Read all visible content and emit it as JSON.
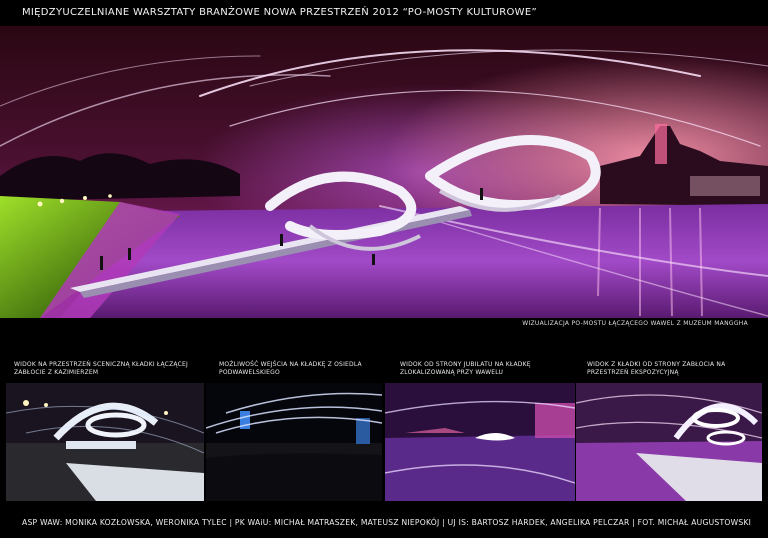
{
  "header": {
    "title": "MIĘDZYUCZELNIANE WARSZTATY BRANŻOWE  NOWA PRZESTRZEŃ 2012 “PO-MOSTY KULTUROWE”"
  },
  "hero": {
    "caption": "WIZUALIZACJA PO-MOSTU ŁĄCZĄCEGO WAWEL Z MUZEUM MANGGHA"
  },
  "thumbnails": [
    {
      "caption": "WIDOK NA PRZESTRZEŃ SCENICZNĄ KŁADKI ŁĄCZĄCEJ ZABŁOCIE Z KAZIMIERZEM"
    },
    {
      "caption": "MOŻLIWOŚĆ WEJŚCIA NA KŁADKĘ Z OSIEDLA PODWAWELSKIEGO"
    },
    {
      "caption": "WIDOK OD STRONY JUBILATU NA KŁADKĘ ZLOKALIZOWANĄ PRZY WAWELU"
    },
    {
      "caption": "WIDOK Z KŁADKI OD STRONY ZABŁOCIA NA PRZESTRZEŃ EKSPOZYCYJNĄ"
    }
  ],
  "footer": {
    "credits": "ASP WAW: MONIKA KOZŁOWSKA, WERONIKA TYLEC | PK WAiU: MICHAŁ MATRASZEK, MATEUSZ NIEPOKÓJ | UJ IS: BARTOSZ HARDEK, ANGELIKA PELCZAR | FOT. MICHAŁ AUGUSTOWSKI"
  }
}
